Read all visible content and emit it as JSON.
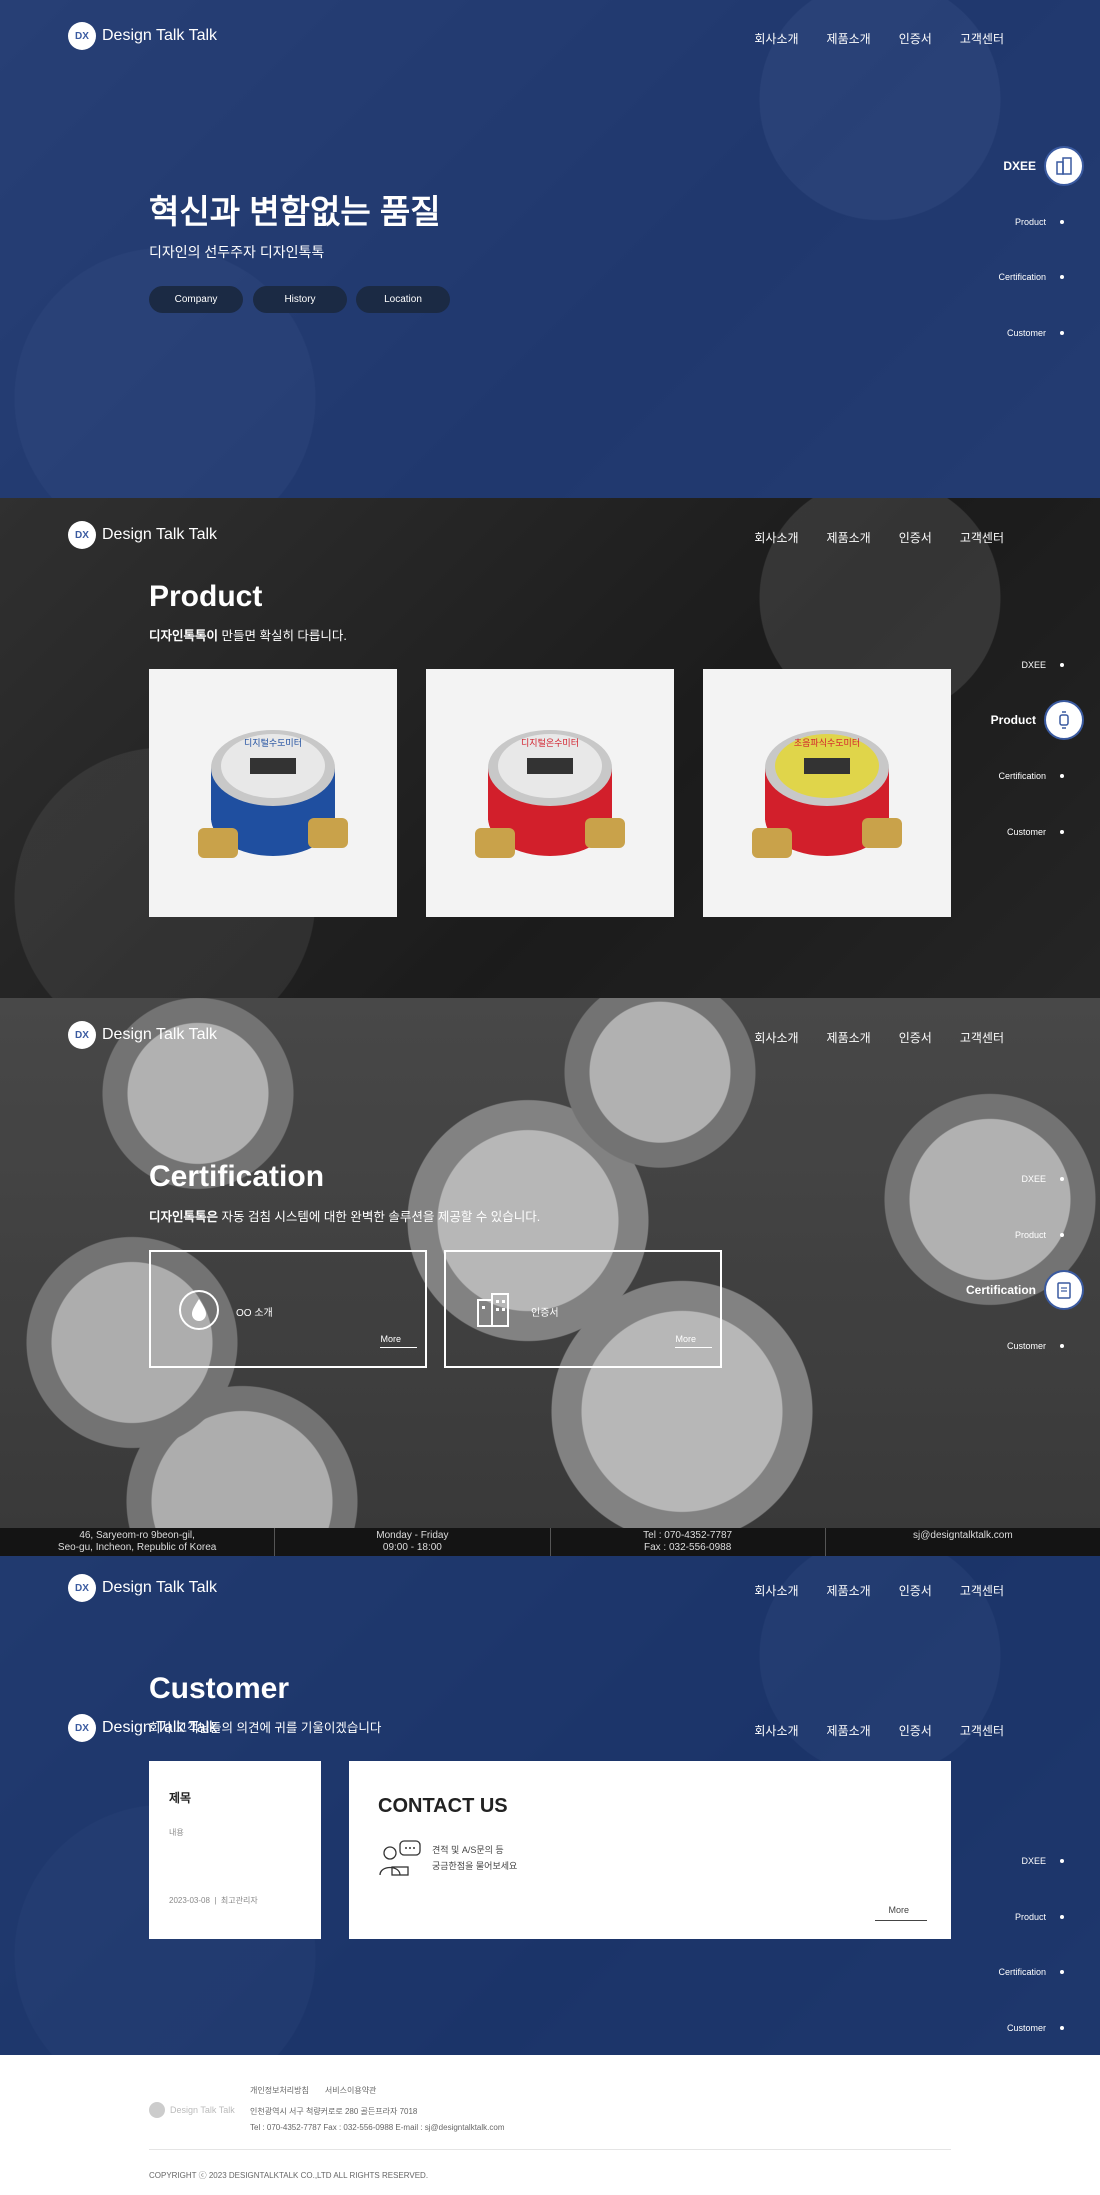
{
  "header": {
    "logo_text": "Design Talk Talk",
    "nav": [
      "회사소개",
      "제품소개",
      "인증서",
      "고객센터"
    ]
  },
  "hero": {
    "title": "혁신과 변함없는 품질",
    "subtitle": "디자인의 선두주자 디자인톡톡",
    "buttons": [
      "Company",
      "History",
      "Location"
    ]
  },
  "side_nav": {
    "items": [
      "DXEE",
      "Product",
      "Certification",
      "Customer"
    ]
  },
  "product": {
    "title": "Product",
    "desc_bold": "디자인톡톡이",
    "desc_rest": " 만들면 확실히 다릅니다.",
    "cards": [
      {
        "label": "디지털수도미터",
        "ring_color": "#1f4fa0",
        "face_color": "#e8e8e8"
      },
      {
        "label": "디지털온수미터",
        "ring_color": "#d21f2b",
        "face_color": "#e8e8e8"
      },
      {
        "label": "초음파식수도미터",
        "ring_color": "#d21f2b",
        "face_color": "#e0d54a"
      }
    ]
  },
  "certification": {
    "title": "Certification",
    "desc_bold": "디자인톡톡은",
    "desc_rest": " 자동 검침 시스템에 대한 완벽한 솔루션을 제공할 수 있습니다.",
    "boxes": [
      {
        "label": "OO 소개",
        "more": "More"
      },
      {
        "label": "인증서",
        "more": "More"
      }
    ]
  },
  "info_bar": {
    "address_line1": "46, Saryeom-ro 9beon-gil,",
    "address_line2": "Seo-gu, Incheon, Republic of Korea",
    "hours_line1": "Monday - Friday",
    "hours_line2": "09:00 - 18:00",
    "tel": "Tel : 070-4352-7787",
    "fax": "Fax : 032-556-0988",
    "email": "sj@designtalktalk.com"
  },
  "customer": {
    "title": "Customer",
    "desc": "회사 고객님들의 의견에 귀를 기울이겠습니다",
    "notice": {
      "title": "제목",
      "body": "내용",
      "date": "2023-03-08",
      "author": "최고관리자"
    },
    "contact": {
      "title": "CONTACT US",
      "line1": "견적 및 A/S문의 등",
      "line2": "궁금한점을 물어보세요",
      "more": "More"
    }
  },
  "footer": {
    "logo_text": "Design Talk Talk",
    "links": [
      "개인정보처리방침",
      "서비스이용약관"
    ],
    "address": "인천광역시 서구 척량커로로 280 골든프라자 7018",
    "contact": "Tel : 070-4352-7787   Fax : 032-556-0988   E-mail : sj@designtalktalk.com",
    "copyright": "COPYRIGHT ⓒ 2023 DESIGNTALKTALK CO.,LTD ALL RIGHTS RESERVED."
  },
  "colors": {
    "brand_blue": "#1e3c82",
    "dark_pill": "#1b2a44"
  }
}
